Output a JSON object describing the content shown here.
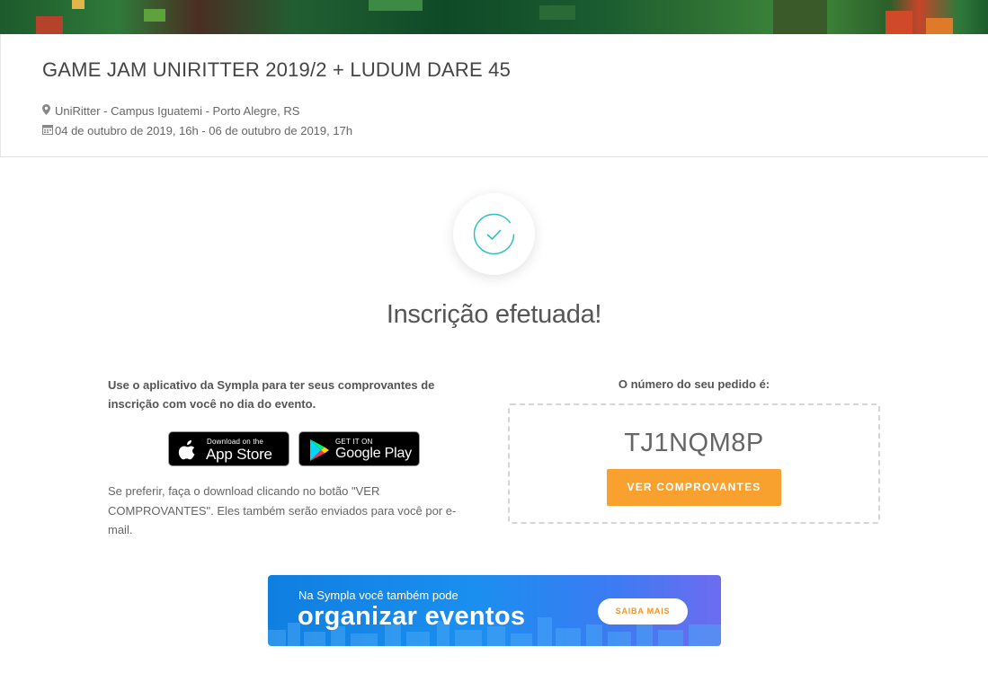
{
  "event": {
    "title": "GAME JAM UNIRITTER 2019/2 + LUDUM DARE 45",
    "location": "UniRitter - Campus Iguatemi - Porto Alegre, RS",
    "date": "04 de outubro de 2019, 16h - 06 de outubro de 2019, 17h",
    "location_icon": "map-marker-icon",
    "date_icon": "calendar-icon"
  },
  "success": {
    "title": "Inscrição efetuada!",
    "icon": "check-icon"
  },
  "app_section": {
    "text": "Use o aplicativo da Sympla para ter seus comprovantes de inscrição com você no dia do evento.",
    "appstore_small": "Download on the",
    "appstore_big": "App Store",
    "googleplay_small": "GET IT ON",
    "googleplay_big": "Google Play",
    "download_text": "Se preferir, faça o download clicando no botão \"VER COMPROVANTES\". Eles também serão enviados para você por e-mail."
  },
  "order": {
    "label": "O número do seu pedido é:",
    "number": "TJ1NQM8P",
    "button": "VER COMPROVANTES"
  },
  "promo": {
    "small": "Na Sympla você também pode",
    "big": "organizar eventos",
    "button": "SAIBA MAIS"
  },
  "colors": {
    "accent": "#f8a12e",
    "check": "#2bbfbf",
    "promo_blue": "#1a8ff0"
  }
}
